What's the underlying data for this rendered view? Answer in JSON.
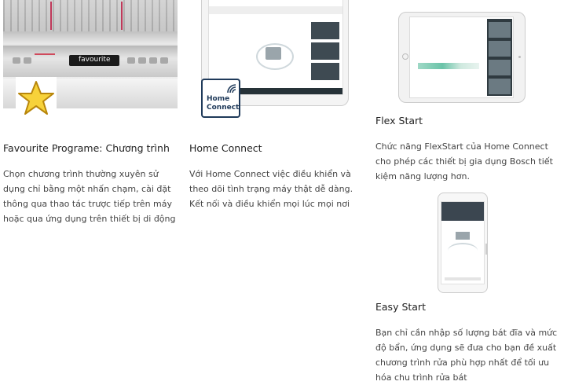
{
  "columns": [
    {
      "title": "Favourite Programe: Chương trình",
      "description": "Chọn chương trình thường xuyên sử dụng chỉ bằng một nhấn chạm, cài đặt thông qua thao tác trược tiếp trên máy hoặc qua ứng dụng trên thiết bị di động",
      "image": {
        "display_text": "favourite",
        "icon": "star-icon"
      }
    },
    {
      "title": "Home Connect",
      "description": "Với Home Connect việc điều khiển và theo dõi tình trạng máy thật dễ dàng. Kết nối và điều khiển mọi lúc mọi nơi",
      "image": {
        "badge_line1": "Home",
        "badge_line2": "Connect",
        "icon": "home-connect-wifi-icon"
      }
    },
    {
      "title": "Flex Start",
      "description": "Chức năng FlexStart của Home Connect cho phép các thiết bị gia dụng Bosch tiết kiệm năng lượng hơn.",
      "image": {
        "icon": "tablet-app-screenshot"
      }
    },
    {
      "title": "Easy Start",
      "description": "Bạn chỉ cần nhập số lượng bát đĩa và mức độ bẩn, ứng dụng sẽ đưa cho bạn đề xuất chương trình rửa phù hợp nhất để tối ưu hóa chu trình rửa bát",
      "image": {
        "icon": "phone-app-screenshot"
      }
    }
  ],
  "colors": {
    "star_fill": "#f7d23a",
    "badge_navy": "#1f3a5a",
    "led_red": "#c0395a"
  }
}
